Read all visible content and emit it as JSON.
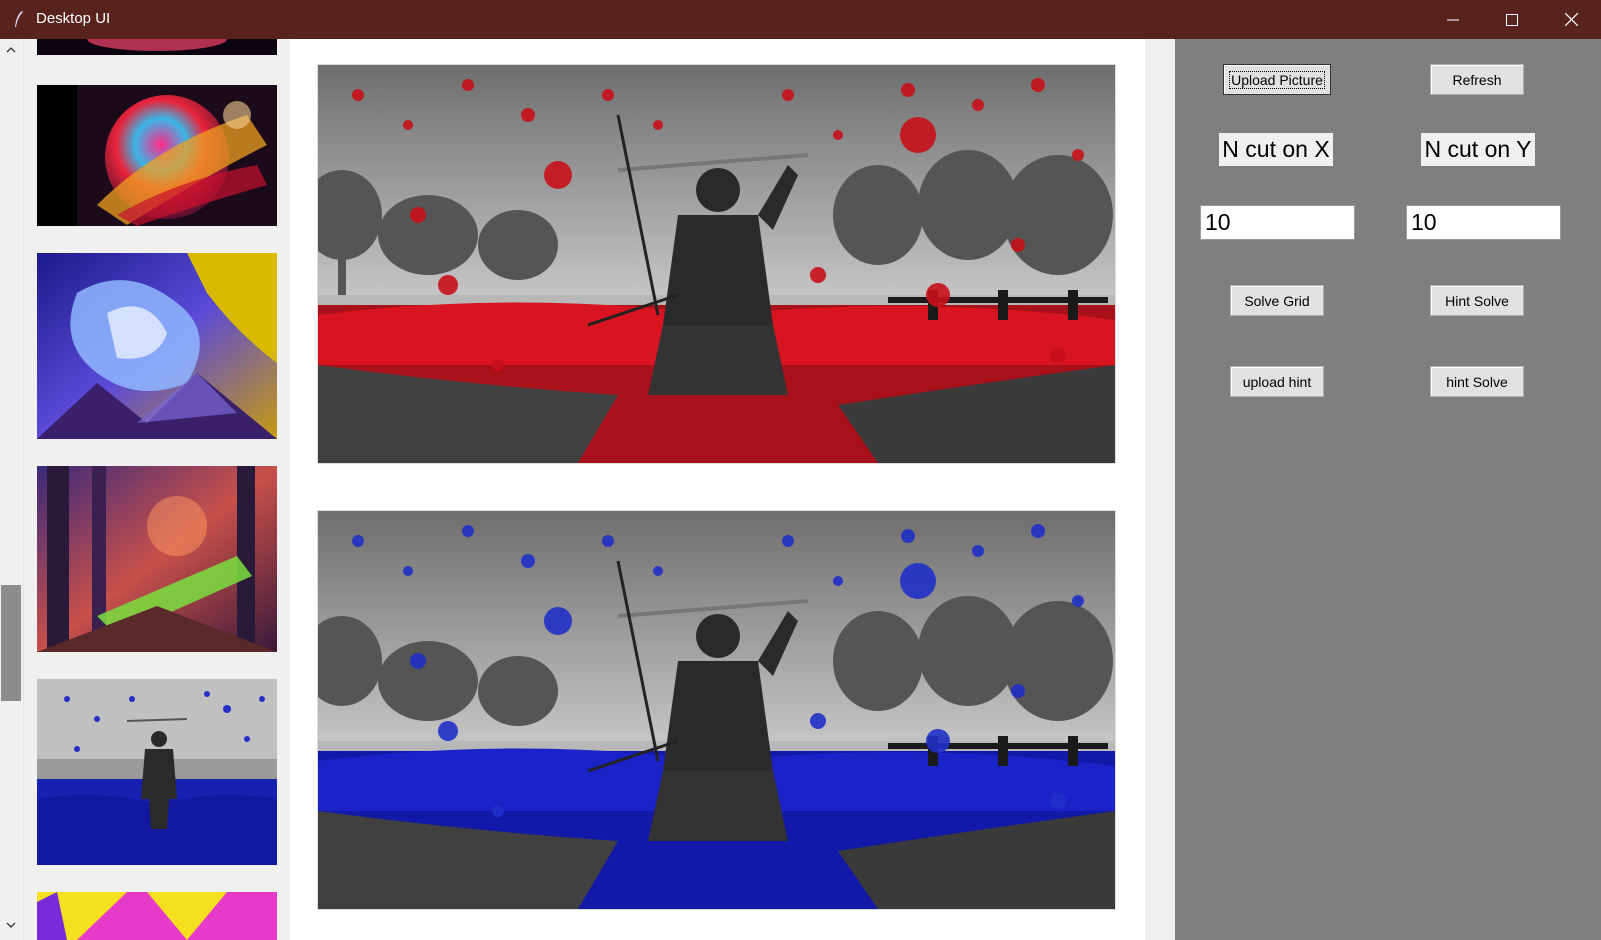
{
  "window": {
    "title": "Desktop UI",
    "icon": "feather-icon",
    "controls": [
      "minimize-icon",
      "maximize-icon",
      "close-icon"
    ]
  },
  "colors": {
    "titlebar": "#58231c",
    "control_panel": "#7f7f7f",
    "canvas": "#ffffff",
    "red_accent": "#c80f14",
    "blue_accent": "#1a1ac0"
  },
  "thumbnails": [
    {
      "name": "cosmic-planet"
    },
    {
      "name": "cosmic-planet"
    },
    {
      "name": "blue-lightning-storm"
    },
    {
      "name": "fantasy-forest"
    },
    {
      "name": "samurai-blue"
    },
    {
      "name": "yellow-purple-abstract"
    }
  ],
  "main_images": [
    {
      "name": "samurai-red",
      "accent": "red"
    },
    {
      "name": "samurai-blue",
      "accent": "blue"
    }
  ],
  "controls": {
    "upload_picture": "Upload Picture",
    "refresh": "Refresh",
    "n_cut_x_label": "N cut on X",
    "n_cut_y_label": "N cut on Y",
    "n_cut_x_value": "10",
    "n_cut_y_value": "10",
    "solve_grid": "Solve Grid",
    "hint_solve_1": "Hint Solve",
    "upload_hint": "upload hint",
    "hint_solve_2": "hint Solve"
  }
}
